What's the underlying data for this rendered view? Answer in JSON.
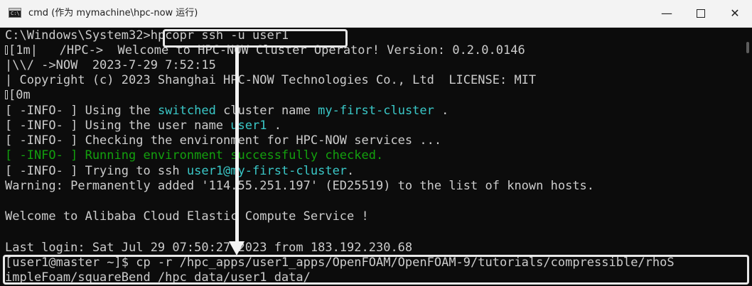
{
  "window": {
    "title": "cmd (作为 mymachine\\hpc-now 运行)",
    "app_icon_glyph": "C:\\",
    "controls": {
      "minimize": "—",
      "close": "✕"
    }
  },
  "terminal": {
    "colors": {
      "background": "#0c0c0c",
      "text": "#cccccc",
      "cyan": "#3ac8c8",
      "green": "#13a10e"
    },
    "lines": {
      "l1": {
        "path": "C:\\Windows\\System32>",
        "command": "hpcopr ssh -u user1"
      },
      "l2": {
        "esc": "[1m",
        "text": "|   /HPC->  Welcome to HPC-NOW Cluster Operator! Version: 0.2.0.0146"
      },
      "l3": {
        "text": "|\\\\/ ->NOW  2023-7-29 7:52:15"
      },
      "l4": {
        "text": "| Copyright (c) 2023 Shanghai HPC-NOW Technologies Co., Ltd  LICENSE: MIT"
      },
      "l5": {
        "esc": "[0m"
      },
      "l6": {
        "pre": "[ -INFO- ] Using the ",
        "hl1": "switched",
        "mid": " cluster name ",
        "hl2": "my-first-cluster",
        "post": " ."
      },
      "l7": {
        "pre": "[ -INFO- ] Using the user name ",
        "hl1": "user1",
        "post": " ."
      },
      "l8": {
        "text": "[ -INFO- ] Checking the environment for HPC-NOW services ..."
      },
      "l9": {
        "text": "[ -INFO- ] Running environment successfully checked."
      },
      "l10": {
        "pre": "[ -INFO- ] Trying to ssh ",
        "hl1": "user1@my-first-cluster",
        "post": "."
      },
      "l11": {
        "text": "Warning: Permanently added '114.55.251.197' (ED25519) to the list of known hosts."
      },
      "l12": {
        "text": "Welcome to Alibaba Cloud Elastic Compute Service !"
      },
      "l13": {
        "text": "Last login: Sat Jul 29 07:50:27 2023 from 183.192.230.68"
      },
      "l14": {
        "text": "[user1@master ~]$ cp -r /hpc_apps/user1_apps/OpenFOAM/OpenFOAM-9/tutorials/compressible/rhoS"
      },
      "l15": {
        "text": "impleFoam/squareBend /hpc_data/user1_data/"
      }
    }
  }
}
